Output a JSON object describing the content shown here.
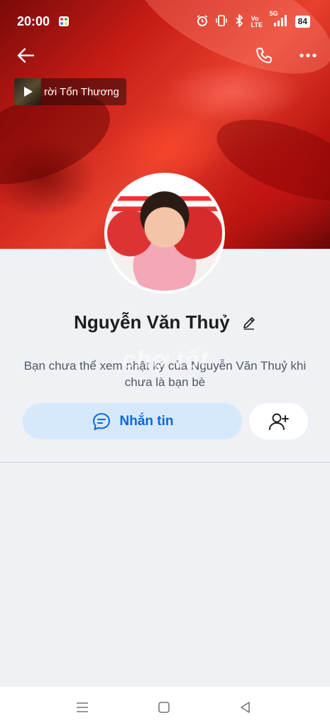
{
  "status_bar": {
    "time": "20:00",
    "volte_label": "Vo LTE",
    "network_label": "5G",
    "battery": "84"
  },
  "cover": {
    "music_title": "rời Tổn Thương"
  },
  "profile": {
    "name": "Nguyễn Văn Thuỷ",
    "notice": "Bạn chưa thể xem nhật ký của Nguyễn Văn Thuỷ khi chưa là bạn bè",
    "watermark": "chợ tốt"
  },
  "actions": {
    "message_label": "Nhắn tin"
  },
  "colors": {
    "accent": "#0a68d8",
    "message_button_bg": "#d6e8fc",
    "page_bg": "#eff1f4"
  }
}
